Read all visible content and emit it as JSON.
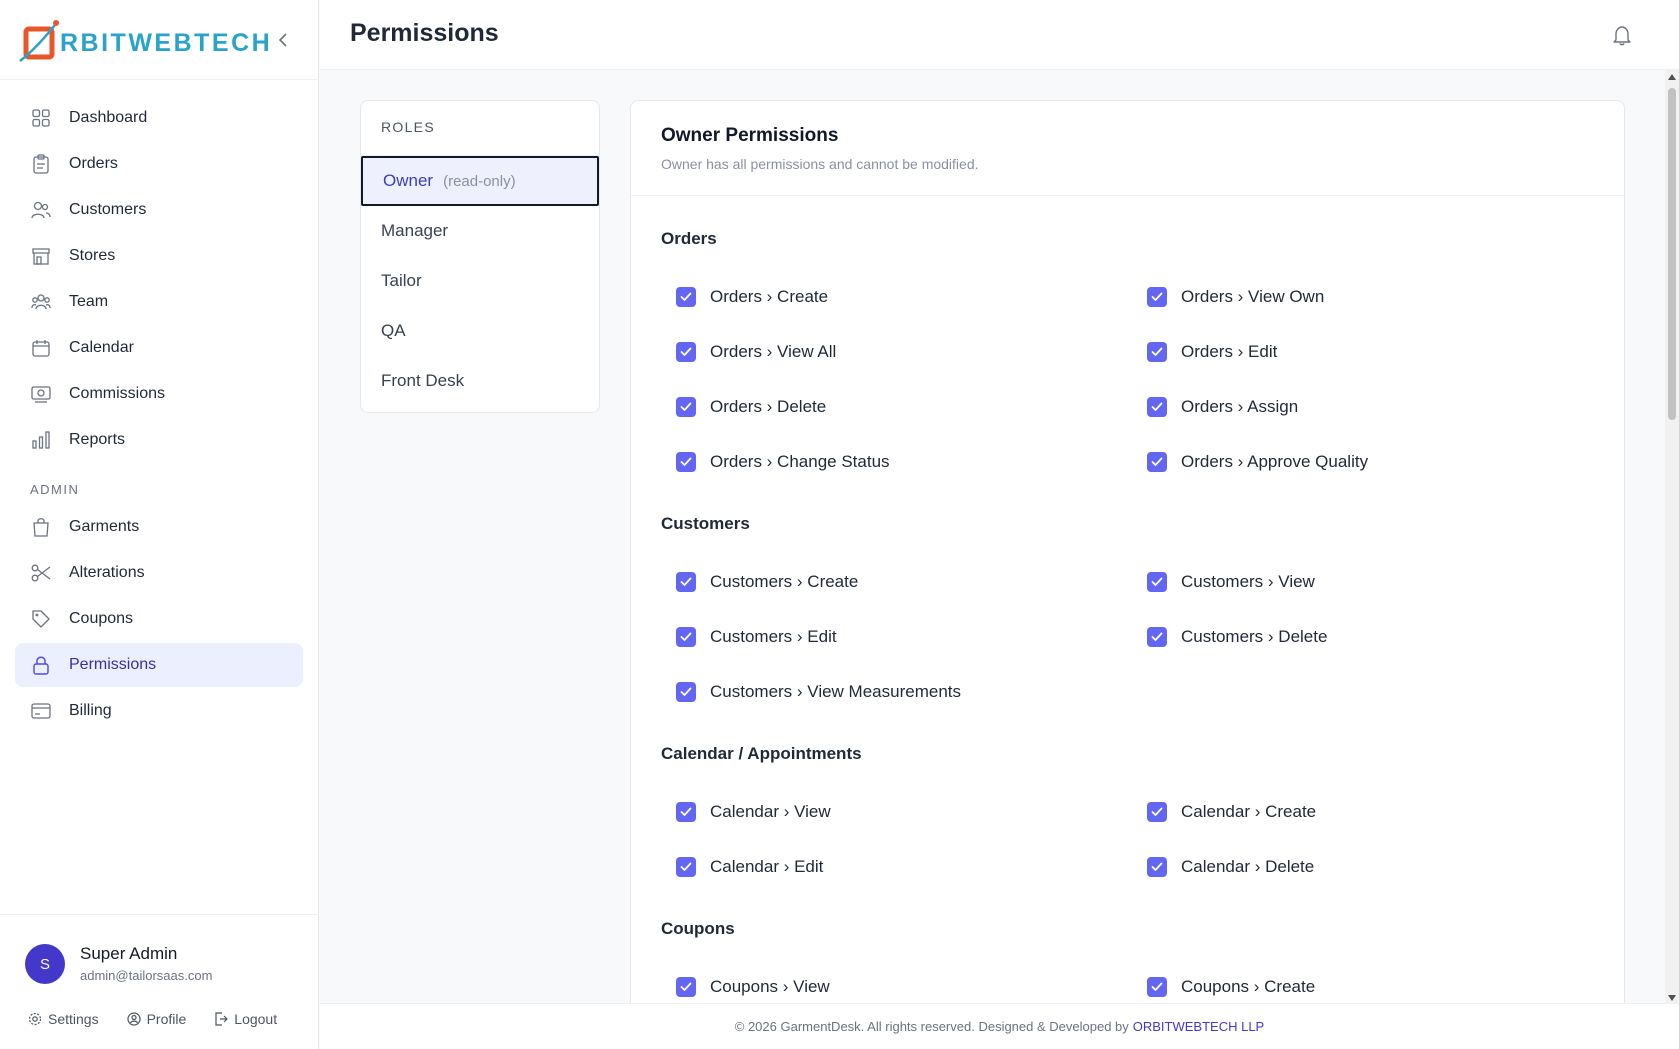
{
  "brand": {
    "name": "RBITWEBTECH"
  },
  "sidebar": {
    "items": [
      {
        "label": "Dashboard",
        "icon": "grid-icon"
      },
      {
        "label": "Orders",
        "icon": "clipboard-icon"
      },
      {
        "label": "Customers",
        "icon": "users-icon"
      },
      {
        "label": "Stores",
        "icon": "store-icon"
      },
      {
        "label": "Team",
        "icon": "team-icon"
      },
      {
        "label": "Calendar",
        "icon": "calendar-icon"
      },
      {
        "label": "Commissions",
        "icon": "commission-icon"
      },
      {
        "label": "Reports",
        "icon": "bar-chart-icon"
      }
    ],
    "admin_label": "ADMIN",
    "admin_items": [
      {
        "label": "Garments",
        "icon": "bag-icon"
      },
      {
        "label": "Alterations",
        "icon": "scissors-icon"
      },
      {
        "label": "Coupons",
        "icon": "tag-icon"
      },
      {
        "label": "Permissions",
        "icon": "lock-icon",
        "active": true
      },
      {
        "label": "Billing",
        "icon": "credit-card-icon"
      }
    ]
  },
  "user": {
    "initial": "S",
    "name": "Super Admin",
    "email": "admin@tailorsaas.com",
    "settings": "Settings",
    "profile": "Profile",
    "logout": "Logout"
  },
  "header": {
    "title": "Permissions"
  },
  "roles": {
    "title": "ROLES",
    "items": [
      {
        "label": "Owner",
        "note": "(read-only)",
        "active": true
      },
      {
        "label": "Manager"
      },
      {
        "label": "Tailor"
      },
      {
        "label": "QA"
      },
      {
        "label": "Front Desk"
      }
    ]
  },
  "permissions": {
    "title": "Owner Permissions",
    "subtitle": "Owner has all permissions and cannot be modified.",
    "groups": [
      {
        "title": "Orders",
        "items": [
          "Orders › Create",
          "Orders › View Own",
          "Orders › View All",
          "Orders › Edit",
          "Orders › Delete",
          "Orders › Assign",
          "Orders › Change Status",
          "Orders › Approve Quality"
        ]
      },
      {
        "title": "Customers",
        "items": [
          "Customers › Create",
          "Customers › View",
          "Customers › Edit",
          "Customers › Delete",
          "Customers › View Measurements"
        ]
      },
      {
        "title": "Calendar / Appointments",
        "items": [
          "Calendar › View",
          "Calendar › Create",
          "Calendar › Edit",
          "Calendar › Delete"
        ]
      },
      {
        "title": "Coupons",
        "items": [
          "Coupons › View",
          "Coupons › Create"
        ]
      }
    ]
  },
  "footer": {
    "text": "© 2026 GarmentDesk. All rights reserved. Designed & Developed by",
    "link": "ORBITWEBTECH LLP"
  },
  "colors": {
    "accent": "#6366f1",
    "brand": "#2aa3c9",
    "active_bg": "#eceffd"
  }
}
